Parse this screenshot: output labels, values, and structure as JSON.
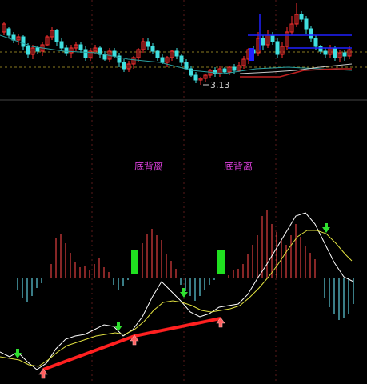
{
  "chart_data": [
    {
      "type": "candlestick",
      "panel": "price",
      "low_marker_text": "3.13",
      "grid": true,
      "candles": [
        [
          5,
          40,
          30,
          44,
          28
        ],
        [
          11,
          36,
          44,
          48,
          34
        ],
        [
          17,
          44,
          50,
          54,
          40
        ],
        [
          23,
          50,
          46,
          56,
          42
        ],
        [
          29,
          46,
          58,
          62,
          44
        ],
        [
          35,
          58,
          68,
          72,
          54
        ],
        [
          41,
          68,
          60,
          74,
          56
        ],
        [
          47,
          60,
          64,
          68,
          58
        ],
        [
          53,
          64,
          56,
          70,
          52
        ],
        [
          59,
          56,
          46,
          58,
          44
        ],
        [
          65,
          46,
          38,
          50,
          34
        ],
        [
          71,
          38,
          52,
          58,
          36
        ],
        [
          77,
          52,
          60,
          64,
          48
        ],
        [
          83,
          60,
          66,
          70,
          56
        ],
        [
          89,
          66,
          60,
          72,
          56
        ],
        [
          95,
          60,
          56,
          64,
          52
        ],
        [
          101,
          56,
          62,
          66,
          52
        ],
        [
          107,
          62,
          72,
          76,
          58
        ],
        [
          113,
          72,
          64,
          76,
          60
        ],
        [
          119,
          64,
          60,
          68,
          56
        ],
        [
          125,
          60,
          68,
          72,
          58
        ],
        [
          131,
          68,
          74,
          76,
          64
        ],
        [
          137,
          74,
          64,
          78,
          60
        ],
        [
          143,
          64,
          70,
          72,
          60
        ],
        [
          149,
          70,
          78,
          84,
          66
        ],
        [
          155,
          78,
          86,
          90,
          74
        ],
        [
          161,
          86,
          80,
          90,
          76
        ],
        [
          167,
          80,
          72,
          86,
          70
        ],
        [
          173,
          72,
          62,
          78,
          60
        ],
        [
          179,
          62,
          52,
          66,
          48
        ],
        [
          185,
          52,
          58,
          62,
          48
        ],
        [
          191,
          58,
          64,
          68,
          54
        ],
        [
          197,
          64,
          72,
          76,
          62
        ],
        [
          203,
          72,
          78,
          80,
          68
        ],
        [
          209,
          78,
          72,
          84,
          70
        ],
        [
          215,
          72,
          64,
          76,
          62
        ],
        [
          221,
          64,
          70,
          74,
          60
        ],
        [
          227,
          70,
          78,
          82,
          68
        ],
        [
          233,
          78,
          86,
          88,
          74
        ],
        [
          239,
          86,
          94,
          96,
          82
        ],
        [
          245,
          94,
          100,
          104,
          90
        ],
        [
          251,
          100,
          98,
          106,
          96
        ],
        [
          257,
          98,
          94,
          102,
          92
        ],
        [
          263,
          94,
          88,
          98,
          86
        ],
        [
          269,
          88,
          92,
          96,
          84
        ],
        [
          275,
          92,
          86,
          96,
          82
        ],
        [
          281,
          86,
          90,
          92,
          84
        ],
        [
          287,
          90,
          84,
          94,
          82
        ],
        [
          293,
          84,
          88,
          92,
          80
        ],
        [
          299,
          88,
          82,
          90,
          78
        ],
        [
          305,
          82,
          74,
          86,
          70
        ],
        [
          311,
          74,
          62,
          80,
          60
        ],
        [
          317,
          62,
          66,
          70,
          58
        ],
        [
          323,
          66,
          48,
          70,
          40
        ],
        [
          329,
          48,
          56,
          62,
          44
        ],
        [
          335,
          56,
          44,
          60,
          38
        ],
        [
          341,
          44,
          52,
          56,
          40
        ],
        [
          347,
          52,
          68,
          72,
          48
        ],
        [
          353,
          68,
          58,
          72,
          52
        ],
        [
          359,
          58,
          40,
          62,
          34
        ],
        [
          365,
          40,
          30,
          44,
          20
        ],
        [
          371,
          30,
          18,
          34,
          4
        ],
        [
          377,
          18,
          24,
          28,
          14
        ],
        [
          383,
          24,
          36,
          42,
          20
        ],
        [
          389,
          36,
          48,
          52,
          32
        ],
        [
          395,
          48,
          58,
          62,
          44
        ],
        [
          401,
          58,
          64,
          68,
          56
        ],
        [
          407,
          64,
          68,
          72,
          60
        ],
        [
          413,
          68,
          60,
          72,
          56
        ],
        [
          419,
          60,
          72,
          76,
          58
        ],
        [
          425,
          72,
          66,
          78,
          62
        ],
        [
          431,
          66,
          70,
          76,
          62
        ],
        [
          437,
          70,
          62,
          74,
          58
        ]
      ],
      "up_color": "#ff3030",
      "down_color": "#40e0e0",
      "ma_color": "#c8c8c8",
      "highlight_color": "#2020ff"
    },
    {
      "type": "macd",
      "panel": "indicator",
      "labels": [
        "底背离",
        "底背离"
      ],
      "label_color": "#e040e0",
      "zero_level": 348,
      "bars": [
        [
          22,
          348,
          362
        ],
        [
          28,
          348,
          372
        ],
        [
          34,
          348,
          378
        ],
        [
          40,
          348,
          370
        ],
        [
          46,
          348,
          360
        ],
        [
          52,
          348,
          354
        ],
        [
          64,
          348,
          330
        ],
        [
          70,
          348,
          298
        ],
        [
          76,
          348,
          292
        ],
        [
          82,
          348,
          304
        ],
        [
          88,
          348,
          316
        ],
        [
          94,
          348,
          328
        ],
        [
          100,
          348,
          334
        ],
        [
          106,
          348,
          332
        ],
        [
          112,
          348,
          338
        ],
        [
          118,
          348,
          330
        ],
        [
          124,
          348,
          322
        ],
        [
          130,
          348,
          334
        ],
        [
          136,
          348,
          340
        ],
        [
          142,
          348,
          356
        ],
        [
          148,
          348,
          362
        ],
        [
          154,
          348,
          358
        ],
        [
          160,
          348,
          350
        ],
        [
          178,
          348,
          304
        ],
        [
          184,
          348,
          292
        ],
        [
          190,
          348,
          286
        ],
        [
          196,
          348,
          294
        ],
        [
          202,
          348,
          300
        ],
        [
          208,
          348,
          318
        ],
        [
          214,
          348,
          326
        ],
        [
          220,
          348,
          336
        ],
        [
          226,
          348,
          356
        ],
        [
          232,
          348,
          364
        ],
        [
          238,
          348,
          370
        ],
        [
          244,
          348,
          376
        ],
        [
          250,
          348,
          370
        ],
        [
          256,
          348,
          362
        ],
        [
          262,
          348,
          356
        ],
        [
          268,
          348,
          350
        ],
        [
          286,
          348,
          344
        ],
        [
          292,
          348,
          338
        ],
        [
          298,
          348,
          336
        ],
        [
          304,
          348,
          330
        ],
        [
          310,
          348,
          318
        ],
        [
          316,
          348,
          306
        ],
        [
          322,
          348,
          294
        ],
        [
          328,
          348,
          270
        ],
        [
          334,
          348,
          262
        ],
        [
          340,
          348,
          280
        ],
        [
          346,
          348,
          290
        ],
        [
          352,
          348,
          300
        ],
        [
          358,
          348,
          306
        ],
        [
          364,
          348,
          294
        ],
        [
          370,
          348,
          280
        ],
        [
          376,
          348,
          296
        ],
        [
          382,
          348,
          308
        ],
        [
          388,
          348,
          316
        ],
        [
          394,
          348,
          324
        ],
        [
          406,
          348,
          372
        ],
        [
          412,
          348,
          384
        ],
        [
          418,
          348,
          392
        ],
        [
          424,
          348,
          400
        ],
        [
          430,
          348,
          398
        ],
        [
          436,
          348,
          392
        ],
        [
          442,
          348,
          380
        ]
      ],
      "green_blocks": [
        [
          168,
          312,
          342
        ],
        [
          276,
          312,
          342
        ]
      ],
      "dif": [
        [
          0,
          440
        ],
        [
          12,
          446
        ],
        [
          22,
          440
        ],
        [
          34,
          452
        ],
        [
          46,
          462
        ],
        [
          58,
          454
        ],
        [
          70,
          436
        ],
        [
          82,
          424
        ],
        [
          94,
          420
        ],
        [
          106,
          418
        ],
        [
          118,
          412
        ],
        [
          130,
          406
        ],
        [
          142,
          408
        ],
        [
          154,
          420
        ],
        [
          166,
          412
        ],
        [
          178,
          396
        ],
        [
          190,
          372
        ],
        [
          202,
          352
        ],
        [
          214,
          364
        ],
        [
          226,
          376
        ],
        [
          238,
          390
        ],
        [
          250,
          396
        ],
        [
          262,
          392
        ],
        [
          274,
          384
        ],
        [
          286,
          382
        ],
        [
          298,
          380
        ],
        [
          310,
          368
        ],
        [
          322,
          348
        ],
        [
          334,
          330
        ],
        [
          346,
          310
        ],
        [
          358,
          290
        ],
        [
          370,
          270
        ],
        [
          382,
          266
        ],
        [
          394,
          280
        ],
        [
          406,
          304
        ],
        [
          418,
          328
        ],
        [
          430,
          346
        ],
        [
          442,
          352
        ]
      ],
      "dea": [
        [
          0,
          446
        ],
        [
          12,
          448
        ],
        [
          24,
          450
        ],
        [
          36,
          456
        ],
        [
          48,
          458
        ],
        [
          60,
          450
        ],
        [
          72,
          440
        ],
        [
          84,
          432
        ],
        [
          96,
          428
        ],
        [
          108,
          424
        ],
        [
          120,
          420
        ],
        [
          132,
          418
        ],
        [
          144,
          416
        ],
        [
          156,
          418
        ],
        [
          168,
          412
        ],
        [
          180,
          402
        ],
        [
          192,
          388
        ],
        [
          204,
          378
        ],
        [
          216,
          376
        ],
        [
          228,
          378
        ],
        [
          240,
          382
        ],
        [
          252,
          388
        ],
        [
          264,
          390
        ],
        [
          276,
          388
        ],
        [
          288,
          386
        ],
        [
          300,
          382
        ],
        [
          312,
          372
        ],
        [
          324,
          360
        ],
        [
          336,
          346
        ],
        [
          348,
          330
        ],
        [
          360,
          312
        ],
        [
          372,
          296
        ],
        [
          384,
          288
        ],
        [
          396,
          288
        ],
        [
          408,
          292
        ],
        [
          420,
          304
        ],
        [
          432,
          318
        ],
        [
          440,
          326
        ]
      ],
      "trend_line": [
        [
          54,
          462
        ],
        [
          168,
          420
        ],
        [
          276,
          398
        ]
      ],
      "trend_color": "#ff2020",
      "buy_arrows": [
        [
          54,
          464
        ],
        [
          168,
          422
        ],
        [
          276,
          400
        ]
      ],
      "sell_arrows": [
        [
          22,
          444
        ],
        [
          148,
          410
        ],
        [
          230,
          368
        ],
        [
          408,
          287
        ]
      ]
    }
  ]
}
